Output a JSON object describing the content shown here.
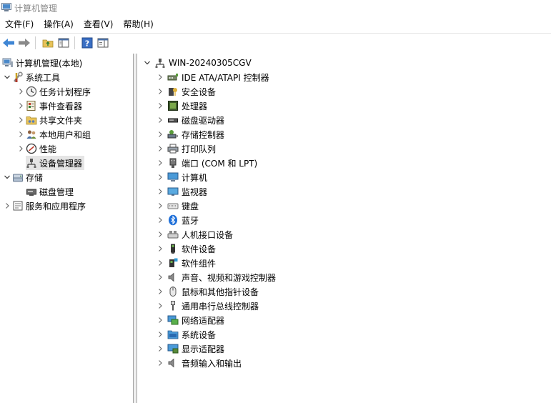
{
  "window": {
    "title": "计算机管理"
  },
  "menu": [
    {
      "label": "文件(F)"
    },
    {
      "label": "操作(A)"
    },
    {
      "label": "查看(V)"
    },
    {
      "label": "帮助(H)"
    }
  ],
  "toolbar": [
    {
      "name": "back-arrow-icon"
    },
    {
      "name": "forward-arrow-icon"
    },
    {
      "name": "up-folder-icon"
    },
    {
      "name": "show-hide-tree-icon"
    },
    {
      "name": "help-icon"
    },
    {
      "name": "properties-icon"
    }
  ],
  "tree": {
    "root": {
      "label": "计算机管理(本地)"
    },
    "items": [
      {
        "label": "系统工具",
        "icon": "tools-icon",
        "level": 1,
        "chevron": "down"
      },
      {
        "label": "任务计划程序",
        "icon": "clock-icon",
        "level": 2,
        "chevron": "right"
      },
      {
        "label": "事件查看器",
        "icon": "event-viewer-icon",
        "level": 2,
        "chevron": "right"
      },
      {
        "label": "共享文件夹",
        "icon": "shared-folder-icon",
        "level": 2,
        "chevron": "right"
      },
      {
        "label": "本地用户和组",
        "icon": "users-icon",
        "level": 2,
        "chevron": "right"
      },
      {
        "label": "性能",
        "icon": "performance-icon",
        "level": 2,
        "chevron": "right"
      },
      {
        "label": "设备管理器",
        "icon": "device-manager-icon",
        "level": 2,
        "chevron": "none",
        "selected": true
      },
      {
        "label": "存储",
        "icon": "storage-icon",
        "level": 1,
        "chevron": "down"
      },
      {
        "label": "磁盘管理",
        "icon": "disk-management-icon",
        "level": 2,
        "chevron": "none"
      },
      {
        "label": "服务和应用程序",
        "icon": "services-icon",
        "level": 1,
        "chevron": "right"
      }
    ]
  },
  "devices": {
    "computer_name": "WIN-20240305CGV",
    "categories": [
      {
        "label": "IDE ATA/ATAPI 控制器",
        "icon": "ide-controller-icon"
      },
      {
        "label": "安全设备",
        "icon": "security-device-icon"
      },
      {
        "label": "处理器",
        "icon": "processor-icon"
      },
      {
        "label": "磁盘驱动器",
        "icon": "disk-drive-icon"
      },
      {
        "label": "存储控制器",
        "icon": "storage-controller-icon"
      },
      {
        "label": "打印队列",
        "icon": "printer-icon"
      },
      {
        "label": "端口 (COM 和 LPT)",
        "icon": "port-icon"
      },
      {
        "label": "计算机",
        "icon": "computer-icon"
      },
      {
        "label": "监视器",
        "icon": "monitor-icon"
      },
      {
        "label": "键盘",
        "icon": "keyboard-icon"
      },
      {
        "label": "蓝牙",
        "icon": "bluetooth-icon"
      },
      {
        "label": "人机接口设备",
        "icon": "hid-icon"
      },
      {
        "label": "软件设备",
        "icon": "software-device-icon"
      },
      {
        "label": "软件组件",
        "icon": "software-component-icon"
      },
      {
        "label": "声音、视频和游戏控制器",
        "icon": "sound-icon"
      },
      {
        "label": "鼠标和其他指针设备",
        "icon": "mouse-icon"
      },
      {
        "label": "通用串行总线控制器",
        "icon": "usb-icon"
      },
      {
        "label": "网络适配器",
        "icon": "network-adapter-icon"
      },
      {
        "label": "系统设备",
        "icon": "system-device-icon"
      },
      {
        "label": "显示适配器",
        "icon": "display-adapter-icon"
      },
      {
        "label": "音频输入和输出",
        "icon": "audio-io-icon"
      }
    ]
  }
}
